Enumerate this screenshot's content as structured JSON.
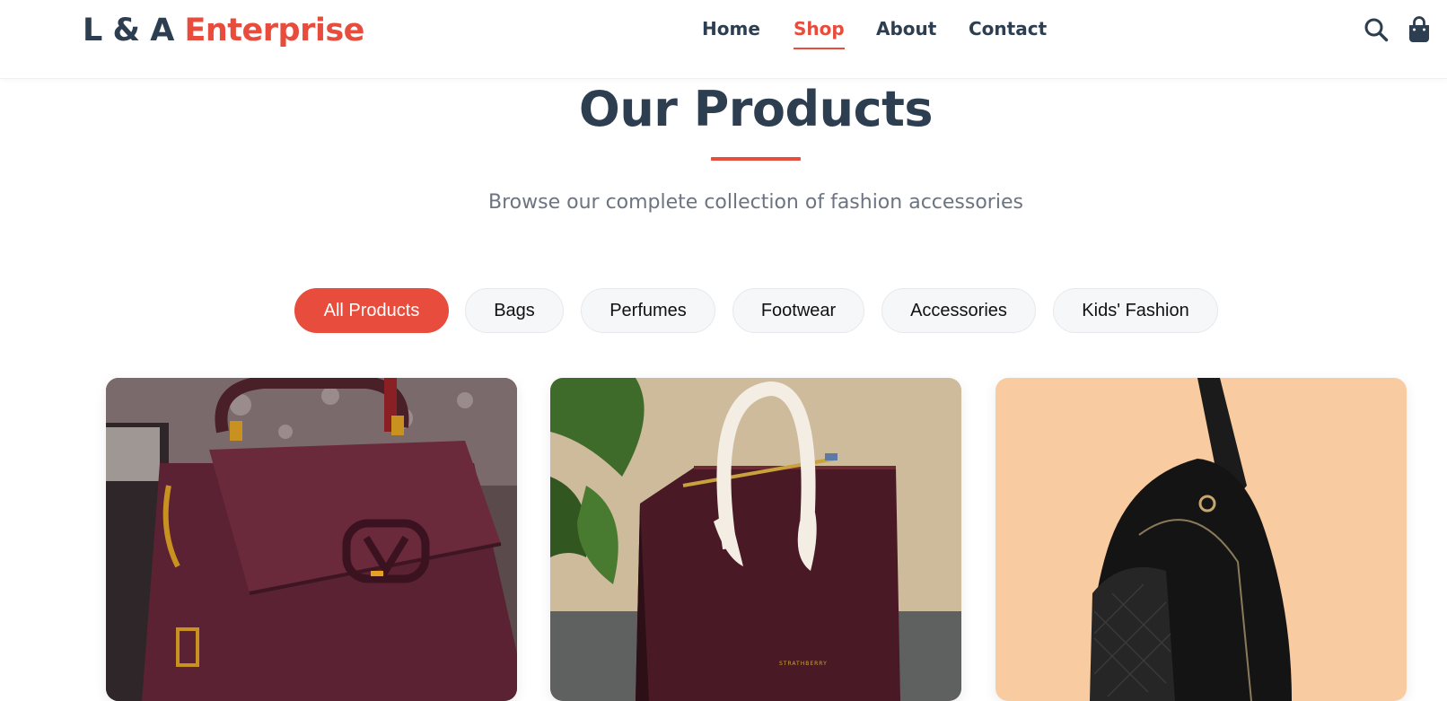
{
  "header": {
    "logo_main": "L & A ",
    "logo_accent": "Enterprise",
    "nav": [
      {
        "label": "Home"
      },
      {
        "label": "Shop",
        "active": true
      },
      {
        "label": "About"
      },
      {
        "label": "Contact"
      }
    ],
    "icons": [
      "search-icon",
      "shopping-bag-icon"
    ]
  },
  "hero": {
    "title": "Our Products",
    "subtitle": "Browse our complete collection of fashion accessories"
  },
  "filters": [
    {
      "label": "All Products",
      "active": true
    },
    {
      "label": "Bags"
    },
    {
      "label": "Perfumes"
    },
    {
      "label": "Footwear"
    },
    {
      "label": "Accessories"
    },
    {
      "label": "Kids' Fashion"
    }
  ],
  "products": [
    {
      "image": "burgundy-handbag-gold-v-logo"
    },
    {
      "image": "burgundy-tote-white-handle"
    },
    {
      "image": "black-sling-backpack"
    }
  ],
  "colors": {
    "accent": "#e74c3c",
    "navy": "#2c3e50",
    "muted": "#6b7480"
  }
}
